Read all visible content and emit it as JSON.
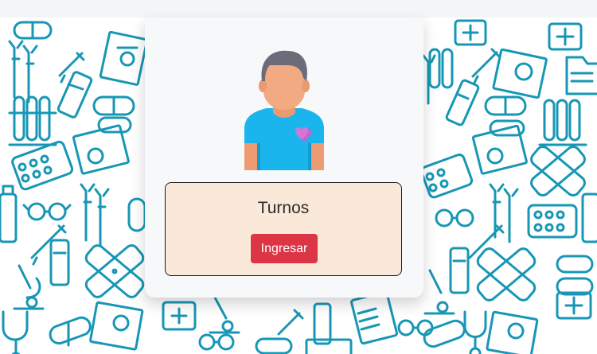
{
  "card": {
    "title": "Turnos",
    "button_label": "Ingresar"
  },
  "colors": {
    "page_topbar": "#f4f5f7",
    "pattern_stroke": "#1797b5",
    "card_background": "#f7f8fa",
    "service_box_background": "#fae9d8",
    "button_background": "#dc3545",
    "avatar_shirt": "#1ab5ec",
    "avatar_skin": "#f0a77f",
    "avatar_hair": "#6b6b7a",
    "avatar_heart": "#c066cf"
  },
  "icons": [
    "medical-pattern-background",
    "doctor-avatar-icon",
    "heart-icon"
  ]
}
